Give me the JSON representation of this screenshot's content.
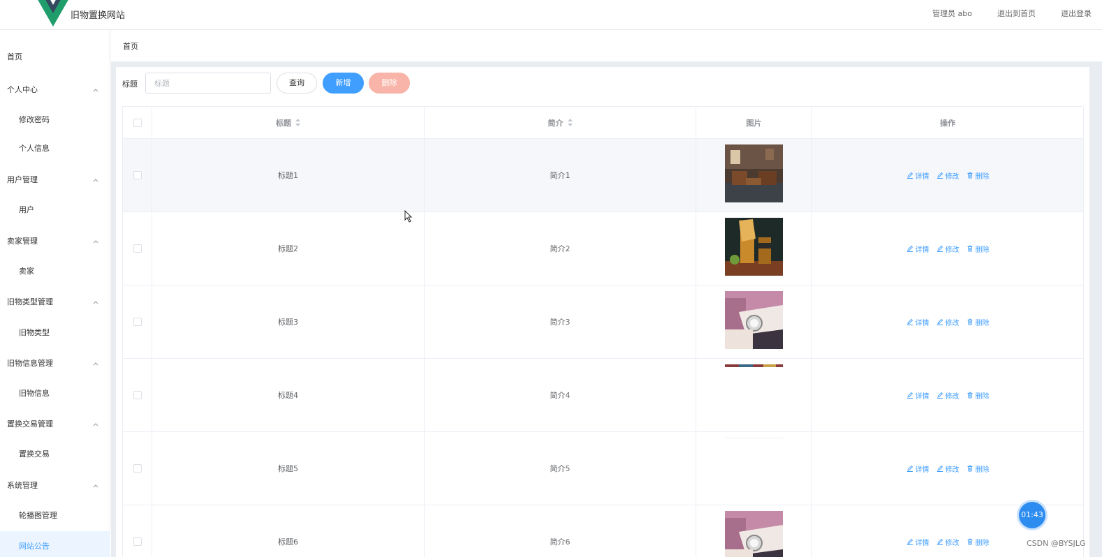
{
  "header": {
    "site_title": "旧物置换网站",
    "user_label": "管理员 abo",
    "back_home": "退出到首页",
    "logout": "退出登录"
  },
  "sidebar": {
    "home": "首页",
    "groups": [
      {
        "label": "个人中心",
        "items": [
          "修改密码",
          "个人信息"
        ]
      },
      {
        "label": "用户管理",
        "items": [
          "用户"
        ]
      },
      {
        "label": "卖家管理",
        "items": [
          "卖家"
        ]
      },
      {
        "label": "旧物类型管理",
        "items": [
          "旧物类型"
        ]
      },
      {
        "label": "旧物信息管理",
        "items": [
          "旧物信息"
        ]
      },
      {
        "label": "置换交易管理",
        "items": [
          "置换交易"
        ]
      },
      {
        "label": "系统管理",
        "items": [
          "轮播图管理",
          "网站公告"
        ]
      }
    ]
  },
  "breadcrumb": "首页",
  "search": {
    "label": "标题",
    "placeholder": "标题",
    "query_btn": "查询",
    "add_btn": "新增",
    "delete_btn": "删除"
  },
  "table": {
    "columns": [
      "标题",
      "简介",
      "图片",
      "操作"
    ],
    "ops": [
      "详情",
      "修改",
      "删除"
    ],
    "rows": [
      {
        "title": "标题1",
        "intro": "简介1",
        "image": "living-room"
      },
      {
        "title": "标题2",
        "intro": "简介2",
        "image": "drink"
      },
      {
        "title": "标题3",
        "intro": "简介3",
        "image": "watch-bag"
      },
      {
        "title": "标题4",
        "intro": "简介4",
        "image": "partial"
      },
      {
        "title": "标题5",
        "intro": "简介5",
        "image": "empty"
      },
      {
        "title": "标题6",
        "intro": "简介6",
        "image": "watch-bag"
      }
    ]
  },
  "timer": "01:43",
  "watermark": "CSDN @BYSJLG",
  "colors": {
    "accent": "#409eff",
    "danger_light": "#f8b4a8",
    "logo_green": "#1f9d6b",
    "logo_dark": "#34495e"
  }
}
